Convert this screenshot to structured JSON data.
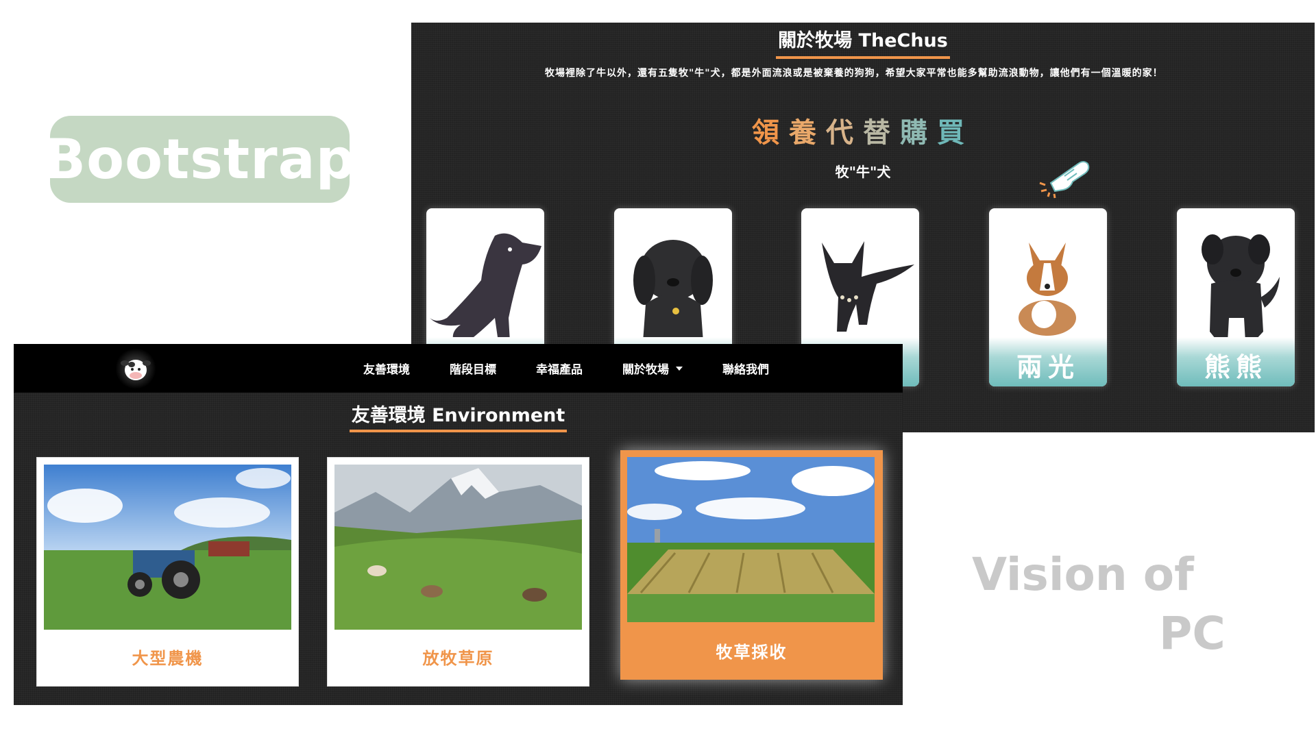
{
  "overlay": {
    "badge": "Bootstrap",
    "vision_line1": "Vision of",
    "vision_line2": "PC"
  },
  "about": {
    "title": "關於牧場 TheChus",
    "description": "牧場裡除了牛以外，還有五隻牧\"牛\"犬，都是外面流浪或是被棄養的狗狗，希望大家平常也能多幫助流浪動物，讓他們有一個溫暖的家！",
    "adopt_heading_chars": [
      "領",
      "養",
      "代",
      "替",
      "購",
      "買"
    ],
    "dogs_subtitle": "牧\"牛\"犬",
    "dogs": [
      {
        "name": "",
        "icon": "dog-sitting-icon"
      },
      {
        "name": "",
        "icon": "dog-floppy-ears-icon"
      },
      {
        "name": "",
        "icon": "dog-stretching-icon"
      },
      {
        "name": "兩光",
        "icon": "corgi-icon"
      },
      {
        "name": "熊熊",
        "icon": "dog-fluffy-icon"
      }
    ]
  },
  "env": {
    "nav": {
      "items": [
        "友善環境",
        "階段目標",
        "幸福產品",
        "關於牧場",
        "聯絡我們"
      ],
      "dropdown_index": 3
    },
    "title": "友善環境 Environment",
    "cards": [
      {
        "label": "大型農機",
        "photo": "tractor-photo",
        "active": false
      },
      {
        "label": "放牧草原",
        "photo": "pasture-cows-photo",
        "active": false
      },
      {
        "label": "牧草採收",
        "photo": "hay-field-photo",
        "active": true
      }
    ]
  },
  "colors": {
    "accent": "#f0954a",
    "panel_bg": "#262626",
    "navbar_bg": "#000000",
    "badge_bg": "#c5d8c3",
    "dog_wave": "#6fbcbb",
    "vision_text": "#c9c9c9"
  }
}
